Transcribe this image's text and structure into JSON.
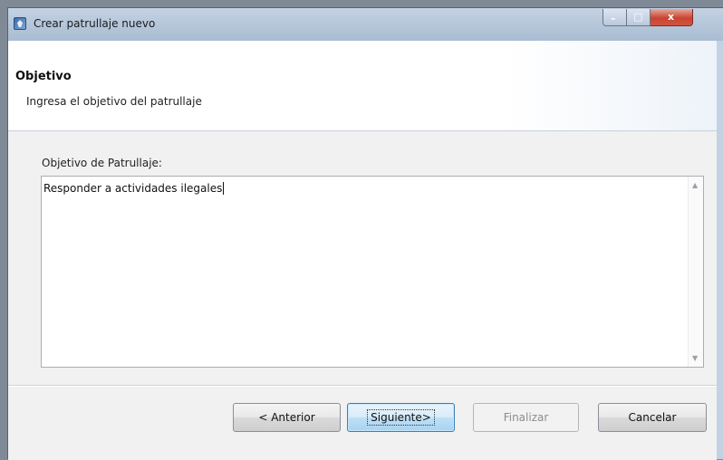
{
  "window": {
    "title": "Crear patrullaje nuevo",
    "controls": {
      "minimize": "–",
      "maximize": "□",
      "close": "x"
    }
  },
  "header": {
    "title": "Objetivo",
    "description": "Ingresa el objetivo del patrullaje"
  },
  "form": {
    "field_label": "Objetivo de Patrullaje:",
    "field_value": "Responder a actividades ilegales"
  },
  "buttons": {
    "previous": "< Anterior",
    "next": "Siguiente>",
    "finish": "Finalizar",
    "cancel": "Cancelar"
  },
  "icons": {
    "app": "app-icon",
    "scroll_up": "scroll-up-arrow-icon",
    "scroll_down": "scroll-down-arrow-icon"
  },
  "colors": {
    "titlebar": "#b7c8db",
    "close_button": "#c84431",
    "default_button_border": "#3c7fb1"
  }
}
